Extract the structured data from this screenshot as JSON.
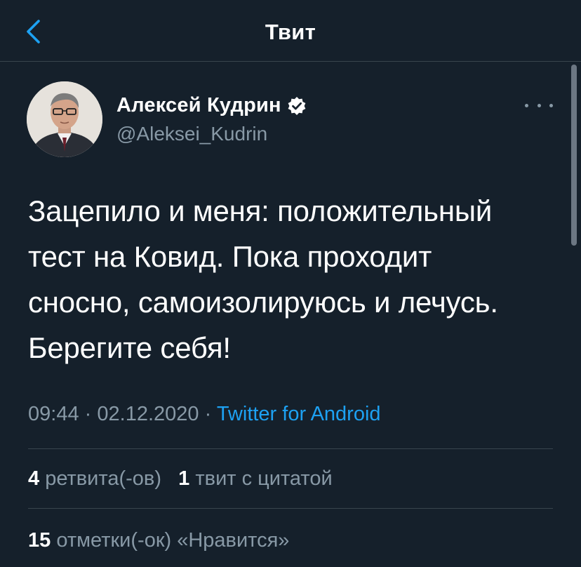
{
  "header": {
    "title": "Твит",
    "back_icon": "chevron-left-icon"
  },
  "colors": {
    "background": "#15202b",
    "accent": "#1da1f2",
    "secondary_text": "#8899a6",
    "divider": "#38444d"
  },
  "tweet": {
    "author": {
      "name": "Алексей Кудрин",
      "handle": "@Aleksei_Kudrin",
      "verified_icon": "verified-badge-icon"
    },
    "more_icon": "more-options-icon",
    "text_lines": [
      "Зацепило и меня: положительный",
      "тест на Ковид. Пока проходит",
      "сносно, самоизолируюсь и лечусь.",
      "Берегите себя!"
    ],
    "time": "09:44",
    "separator": "·",
    "date": "02.12.2020",
    "source": "Twitter for Android"
  },
  "stats": {
    "retweets_count": "4",
    "retweets_label": "ретвита(-ов)",
    "quotes_count": "1",
    "quotes_label": "твит с цитатой",
    "likes_count": "15",
    "likes_label": "отметки(-ок) «Нравится»"
  }
}
